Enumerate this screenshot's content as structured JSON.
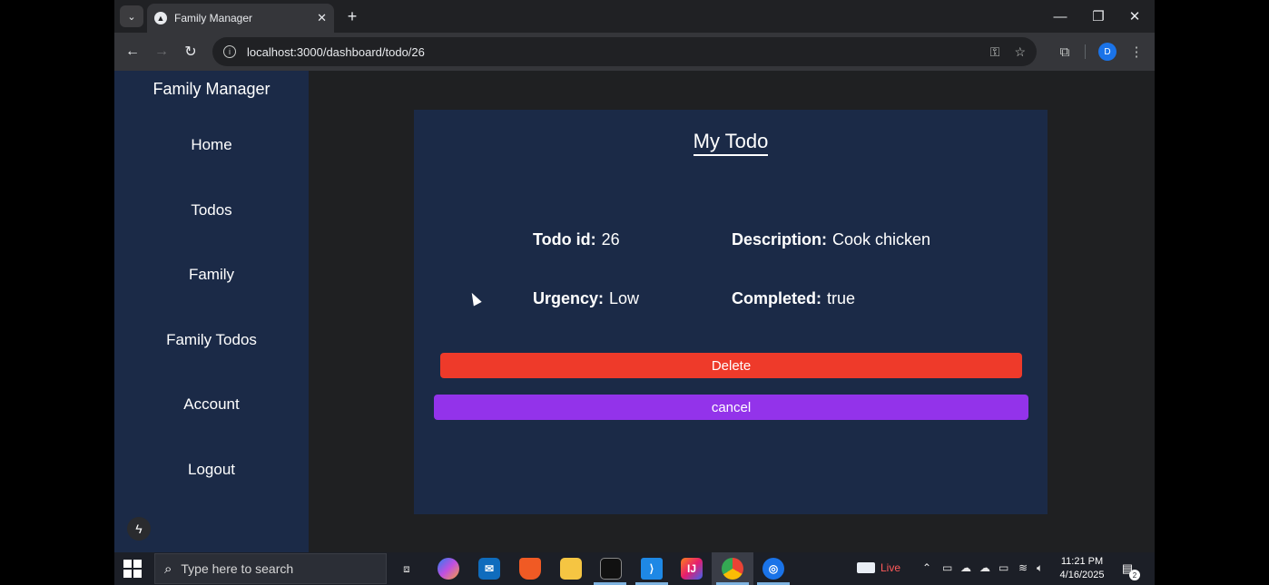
{
  "browser": {
    "tab_title": "Family Manager",
    "url": "localhost:3000/dashboard/todo/26",
    "profile_initial": "D"
  },
  "sidebar": {
    "brand": "Family Manager",
    "items": [
      {
        "label": "Home"
      },
      {
        "label": "Todos"
      },
      {
        "label": "Family"
      },
      {
        "label": "Family Todos"
      },
      {
        "label": "Account"
      },
      {
        "label": "Logout"
      }
    ]
  },
  "card": {
    "title": "My Todo",
    "fields": {
      "todo_id": {
        "label": "Todo id:",
        "value": "26"
      },
      "description": {
        "label": "Description:",
        "value": "Cook chicken"
      },
      "urgency": {
        "label": "Urgency:",
        "value": "Low"
      },
      "completed": {
        "label": "Completed:",
        "value": "true"
      }
    },
    "delete_label": "Delete",
    "cancel_label": "cancel"
  },
  "colors": {
    "sidebar_bg": "#1b2a47",
    "card_bg": "#1b2a47",
    "delete_button": "#ee3a2a",
    "cancel_button": "#9333ea"
  },
  "taskbar": {
    "search_placeholder": "Type here to search",
    "live_label": "Live",
    "time": "11:21 PM",
    "date": "4/16/2025",
    "notification_count": "2"
  }
}
